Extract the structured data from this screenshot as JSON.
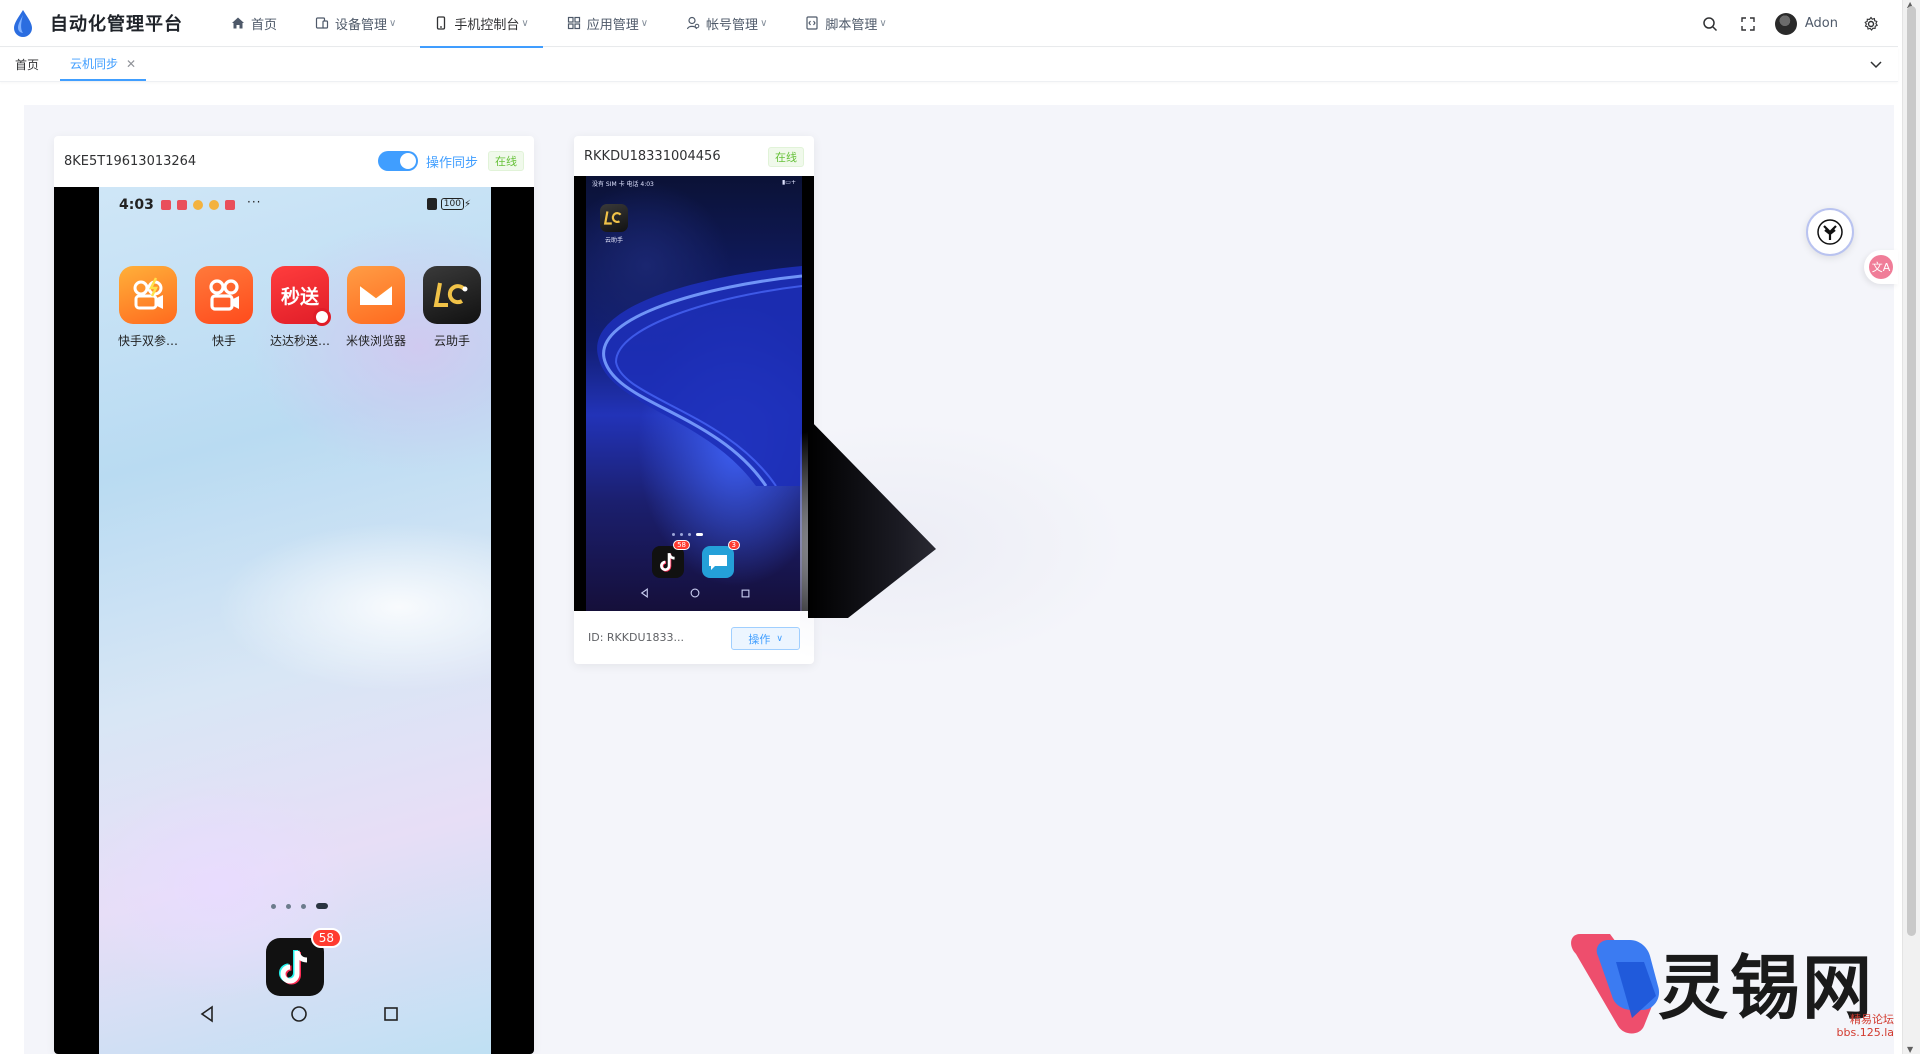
{
  "app": {
    "title": "自动化管理平台"
  },
  "nav": {
    "items": [
      {
        "label": "首页",
        "icon": "home-icon"
      },
      {
        "label": "设备管理",
        "icon": "device-icon"
      },
      {
        "label": "手机控制台",
        "icon": "phone-icon",
        "active": true
      },
      {
        "label": "应用管理",
        "icon": "grid-icon"
      },
      {
        "label": "帐号管理",
        "icon": "user-icon"
      },
      {
        "label": "脚本管理",
        "icon": "code-icon"
      }
    ]
  },
  "user": {
    "name": "Adon"
  },
  "tabs": [
    {
      "label": "首页"
    },
    {
      "label": "云机同步",
      "active": true
    }
  ],
  "devices": [
    {
      "id": "8KE5T19613013264",
      "sync_label": "操作同步",
      "sync_on": true,
      "status": "在线",
      "screen": {
        "time": "4:03",
        "battery": "100",
        "apps": [
          "快手双参…",
          "快手",
          "达达秒送…",
          "米侠浏览器",
          "云助手"
        ],
        "dd_icon_text": "秒送",
        "dock_badge": "58"
      }
    },
    {
      "id": "RKKDU18331004456",
      "status": "在线",
      "short_id": "ID: RKKDU1833...",
      "op_label": "操作",
      "screen": {
        "status_left": "没有 SIM 卡 电话 4:03",
        "app_label": "云助手",
        "dock_badges": [
          "58",
          "3"
        ]
      }
    }
  ],
  "watermark": {
    "brand": "灵锡网",
    "site_name": "精易论坛",
    "site_url": "bbs.125.la"
  },
  "float": {
    "translate_label": "文A"
  },
  "colors": {
    "accent": "#409eff",
    "success": "#67c23a",
    "bg": "#f4f5fa"
  }
}
